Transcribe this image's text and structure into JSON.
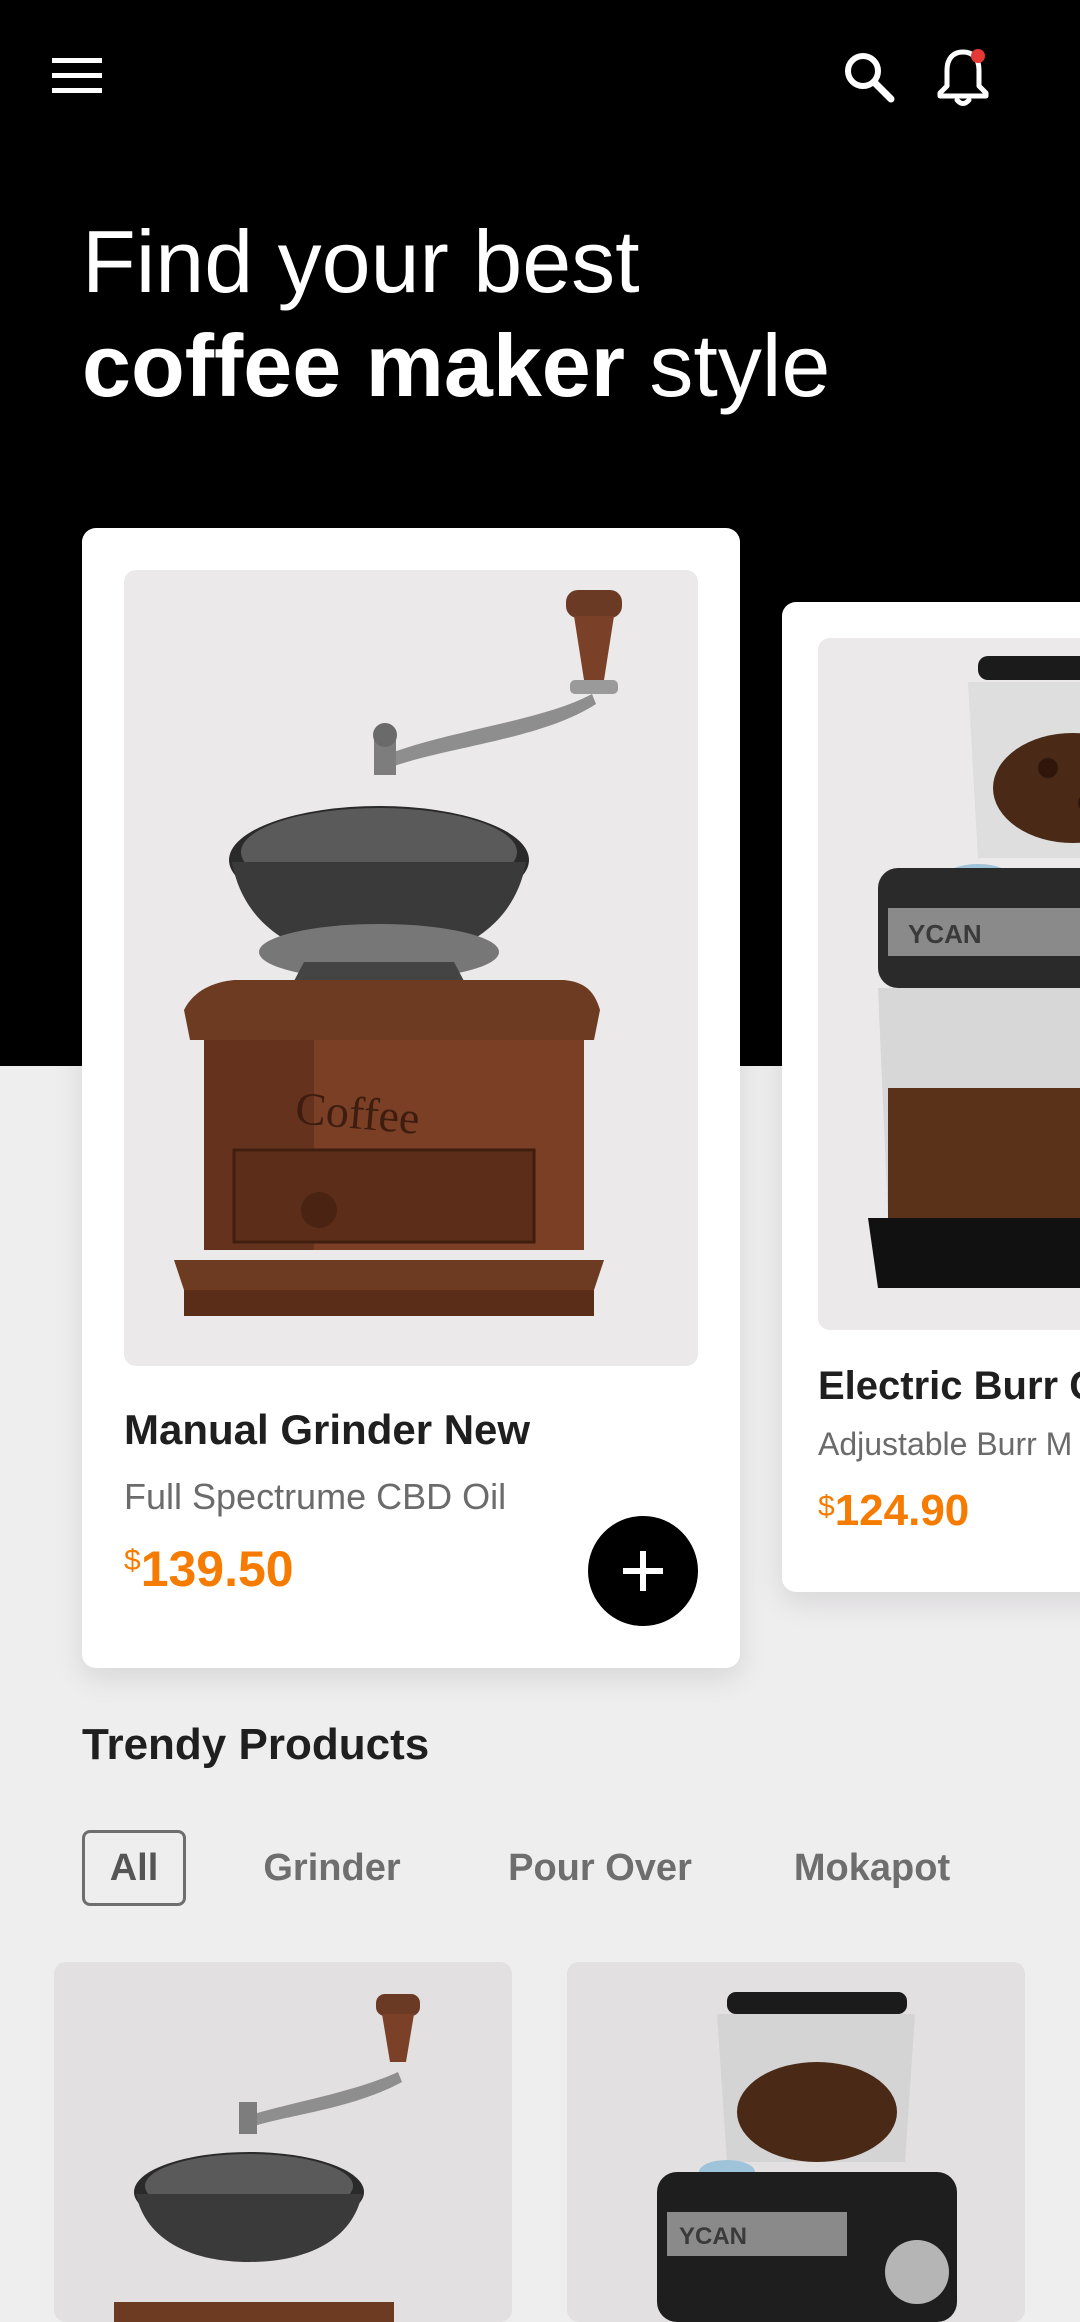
{
  "headline": {
    "line1": "Find your best",
    "bold": "coffee maker",
    "rest": " style"
  },
  "featured": [
    {
      "title": "Manual Grinder New",
      "subtitle": "Full Spectrume CBD Oil",
      "currency": "$",
      "price": "139.50"
    },
    {
      "title": "Electric Burr Co",
      "subtitle": "Adjustable Burr M",
      "currency": "$",
      "price": "124.90"
    }
  ],
  "section": {
    "title": "Trendy Products"
  },
  "categories": [
    {
      "label": "All",
      "active": true
    },
    {
      "label": "Grinder",
      "active": false
    },
    {
      "label": "Pour Over",
      "active": false
    },
    {
      "label": "Mokapot",
      "active": false
    }
  ],
  "icons": {
    "menu": "menu-icon",
    "search": "search-icon",
    "notifications": "bell-icon",
    "add": "plus-icon"
  },
  "colors": {
    "accent": "#f57c00",
    "notification_dot": "#e53935",
    "hero_bg": "#000000"
  }
}
